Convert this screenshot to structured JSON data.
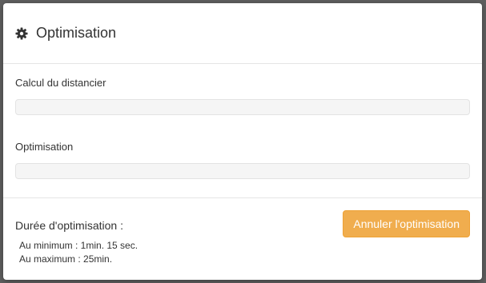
{
  "modal": {
    "title": "Optimisation",
    "icon": "gear-icon"
  },
  "progress": [
    {
      "label": "Calcul du distancier",
      "value": 0
    },
    {
      "label": "Optimisation",
      "value": 0
    }
  ],
  "footer": {
    "duration_title": "Durée d'optimisation :",
    "min_line": "Au minimum : 1min. 15 sec.",
    "max_line": "Au maximum : 25min.",
    "cancel_label": "Annuler l'optimisation"
  },
  "colors": {
    "accent": "#f0ad4e",
    "progress_bg": "#f5f5f5"
  }
}
